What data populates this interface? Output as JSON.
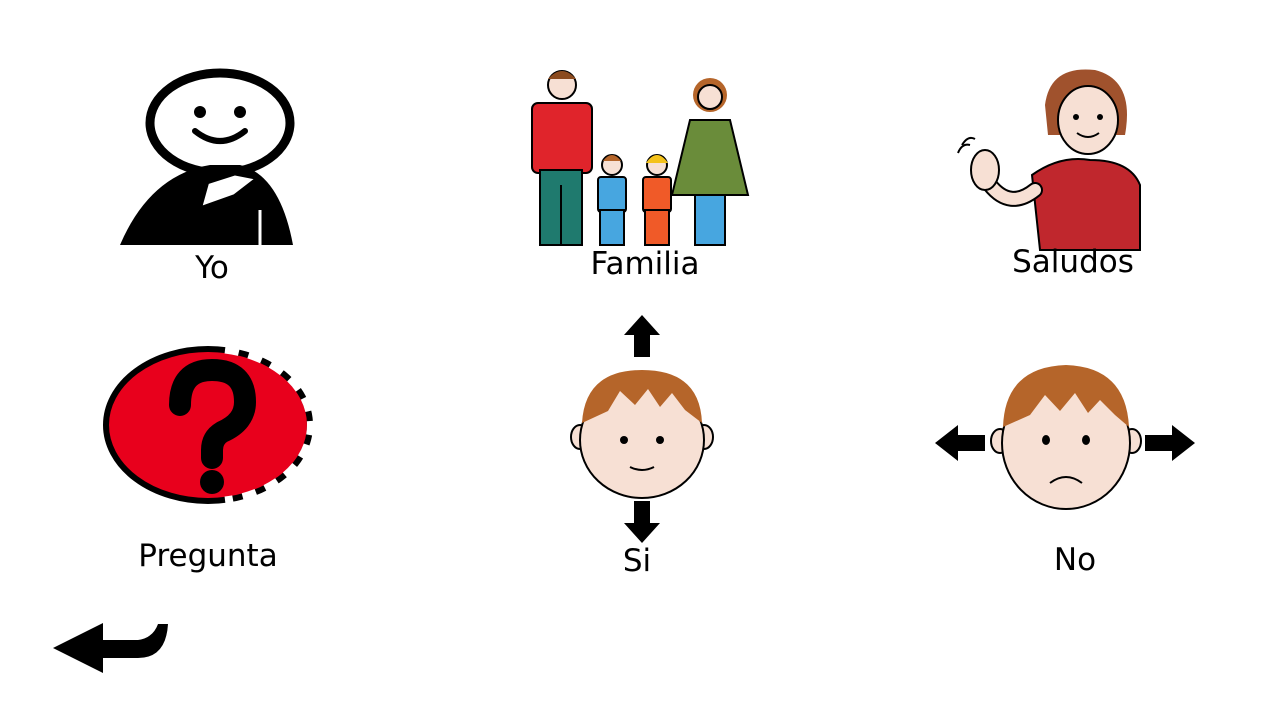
{
  "board": {
    "items": [
      {
        "label": "Yo",
        "icon": "pointing-to-self-icon"
      },
      {
        "label": "Familia",
        "icon": "family-icon"
      },
      {
        "label": "Saludos",
        "icon": "waving-person-icon"
      },
      {
        "label": "Pregunta",
        "icon": "question-mark-icon"
      },
      {
        "label": "Si",
        "icon": "nodding-face-icon"
      },
      {
        "label": "No",
        "icon": "shaking-head-face-icon"
      }
    ]
  },
  "navigation": {
    "back_icon": "back-arrow-icon"
  },
  "colors": {
    "question_red": "#e8001c",
    "family_red": "#e0242b",
    "family_green": "#6a8c3a",
    "skin": "#f7e0d4",
    "hair": "#b5652a"
  }
}
